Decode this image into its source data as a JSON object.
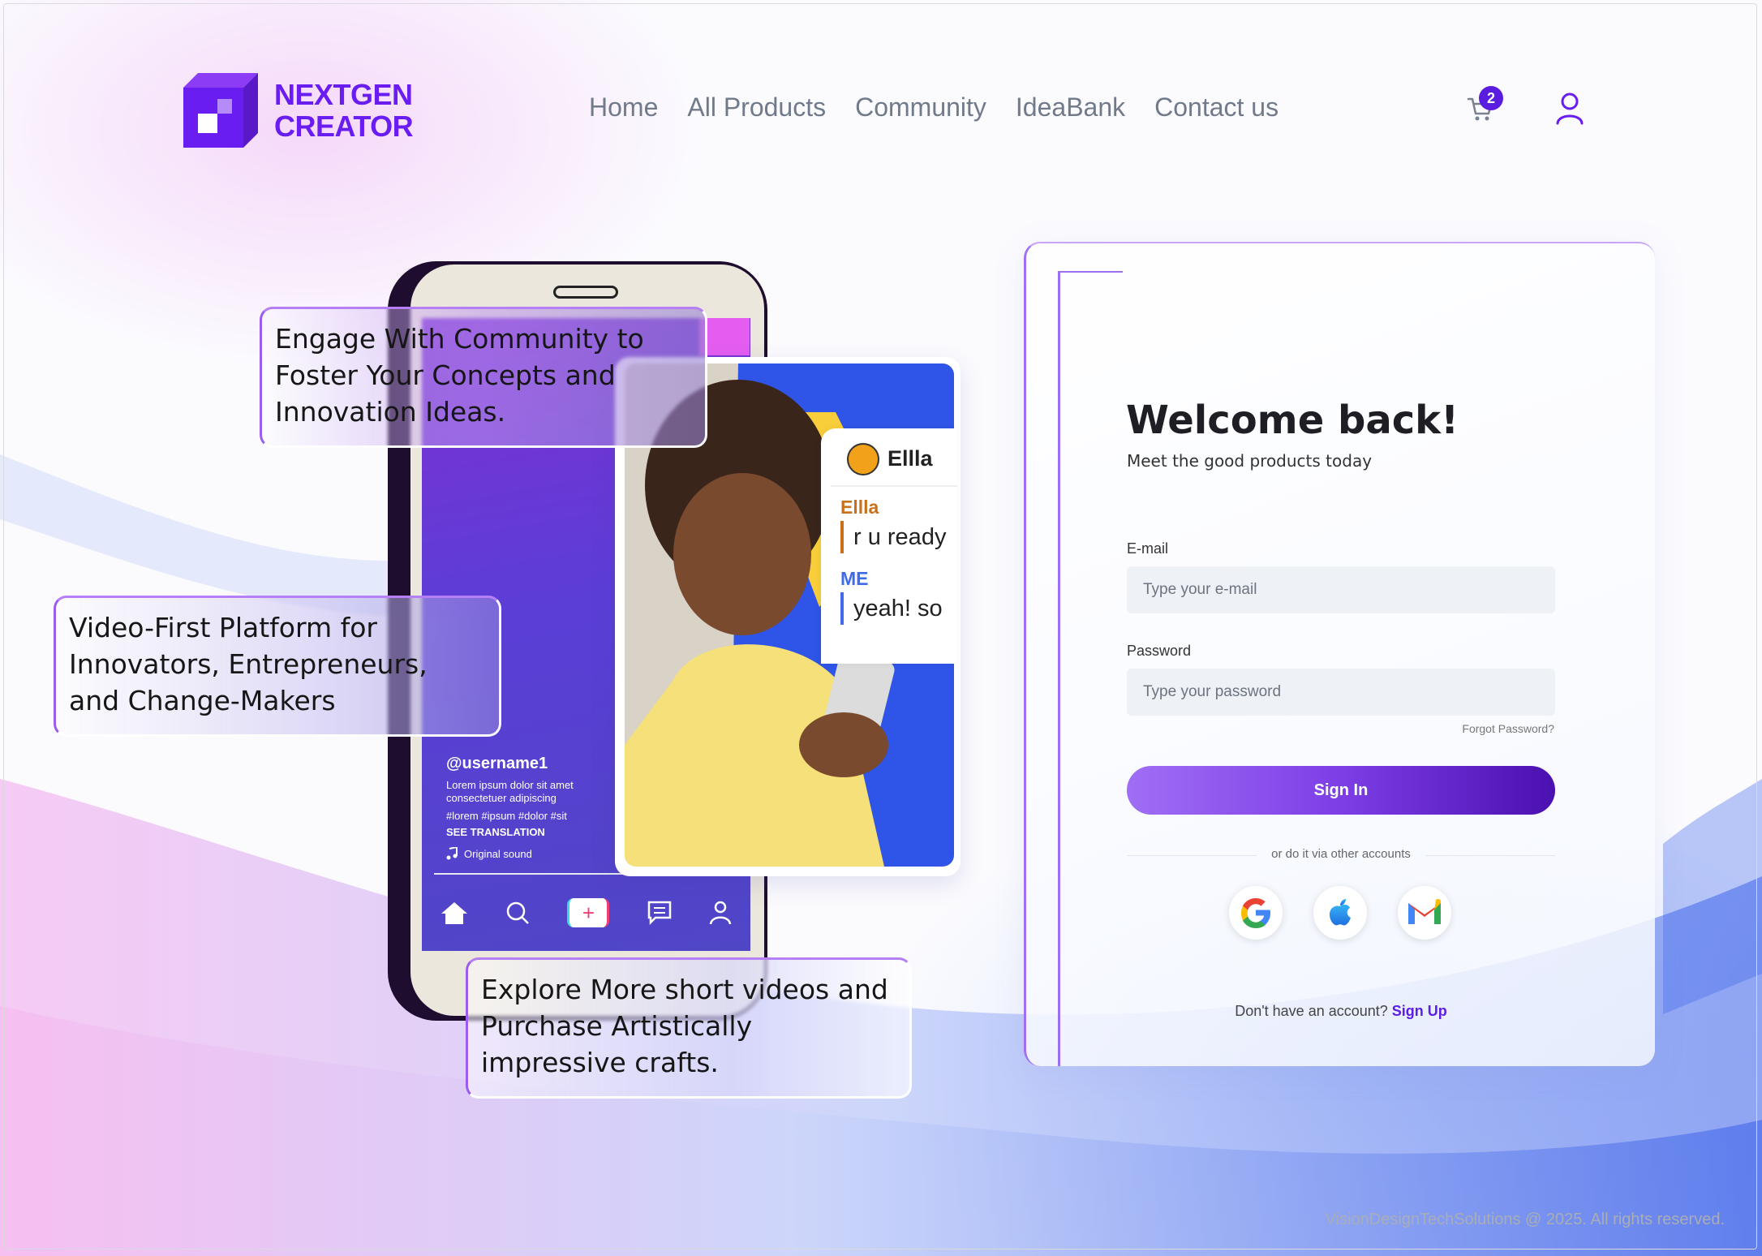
{
  "brand": {
    "line1": "NEXTGEN",
    "line2": "CREATOR",
    "color": "#6a1df0"
  },
  "nav": [
    "Home",
    "All Products",
    "Community",
    "IdeaBank",
    "Contact us"
  ],
  "cart": {
    "count": "2"
  },
  "icons": {
    "cart": "cart-icon",
    "user": "user-icon"
  },
  "callouts": [
    "Engage With Community to Foster Your Concepts and Innovation Ideas.",
    "Video-First Platform for Innovators, Entrepreneurs, and Change-Makers",
    "Explore More short videos and Purchase Artistically impressive crafts."
  ],
  "phone": {
    "username": "@username1",
    "description": "Lorem ipsum dolor sit amet consectetuer adipiscing",
    "tags": "#lorem #ipsum #dolor #sit",
    "translation": "SEE TRANSLATION",
    "sound": "Original sound"
  },
  "chat": {
    "title": "Ellla",
    "name1": "Ellla",
    "msg1": "r u ready",
    "name2": "ME",
    "msg2": "yeah! so"
  },
  "login": {
    "title": "Welcome back!",
    "subtitle": "Meet the good products today",
    "email_label": "E-mail",
    "email_placeholder": "Type your e-mail",
    "password_label": "Password",
    "password_placeholder": "Type your password",
    "forgot": "Forgot Password?",
    "signin": "Sign In",
    "or": "or do it via other accounts",
    "no_account": "Don't have an account?",
    "signup": "Sign Up",
    "accent": "#5b1ee6"
  },
  "footer": "VisionDesignTechSolutions @ 2025. All rights reserved."
}
